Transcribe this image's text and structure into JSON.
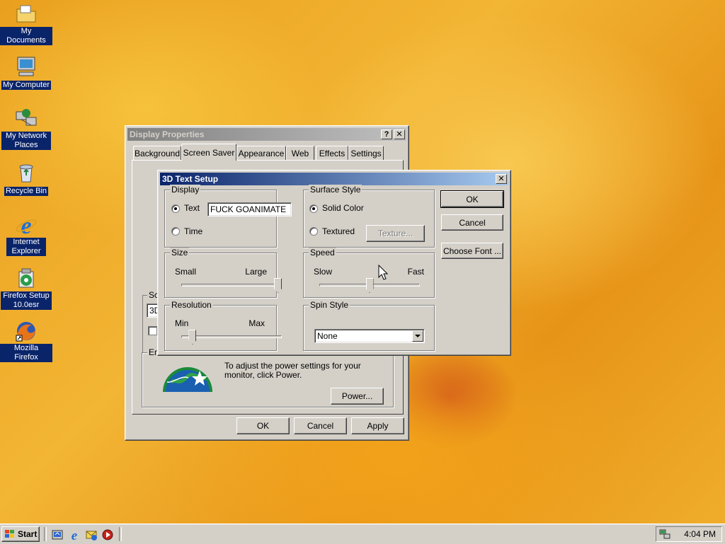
{
  "desktop": {
    "icons": [
      {
        "label": "My Documents",
        "icon": "folder-documents-icon"
      },
      {
        "label": "My Computer",
        "icon": "computer-icon"
      },
      {
        "label": "My Network Places",
        "icon": "network-icon"
      },
      {
        "label": "Recycle Bin",
        "icon": "recycle-bin-icon"
      },
      {
        "label": "Internet Explorer",
        "icon": "internet-explorer-icon"
      },
      {
        "label": "Firefox Setup 10.0esr",
        "icon": "installer-icon"
      },
      {
        "label": "Mozilla Firefox",
        "icon": "firefox-icon"
      }
    ]
  },
  "display_properties": {
    "title": "Display Properties",
    "help_label": "?",
    "close_label": "✕",
    "tabs": [
      "Background",
      "Screen Saver",
      "Appearance",
      "Web",
      "Effects",
      "Settings"
    ],
    "selected_tab": "Screen Saver",
    "screensaver_group_label": "Sc",
    "screensaver_select_value": "3D",
    "energy_group_label": "En",
    "energy_text": "To adjust the power settings for your monitor, click Power.",
    "power_button": "Power...",
    "ok_button": "OK",
    "cancel_button": "Cancel",
    "apply_button": "Apply"
  },
  "text_setup": {
    "title": "3D Text Setup",
    "close_label": "✕",
    "display": {
      "group_label": "Display",
      "text_option": "Text",
      "text_value": "FUCK GOANIMATE",
      "time_option": "Time",
      "selected": "Text"
    },
    "surface": {
      "group_label": "Surface Style",
      "solid_option": "Solid Color",
      "textured_option": "Textured",
      "texture_button": "Texture...",
      "selected": "Solid Color"
    },
    "size": {
      "group_label": "Size",
      "min_label": "Small",
      "max_label": "Large",
      "value": 1.0
    },
    "speed": {
      "group_label": "Speed",
      "min_label": "Slow",
      "max_label": "Fast",
      "value": 0.5
    },
    "resolution": {
      "group_label": "Resolution",
      "min_label": "Min",
      "max_label": "Max",
      "value": 0.08
    },
    "spin": {
      "group_label": "Spin Style",
      "value": "None"
    },
    "ok_button": "OK",
    "cancel_button": "Cancel",
    "choose_font_button": "Choose Font ..."
  },
  "taskbar": {
    "start_label": "Start",
    "clock": "4:04 PM",
    "quick_launch": [
      "show-desktop-icon",
      "internet-explorer-icon",
      "outlook-icon",
      "media-player-icon"
    ]
  }
}
